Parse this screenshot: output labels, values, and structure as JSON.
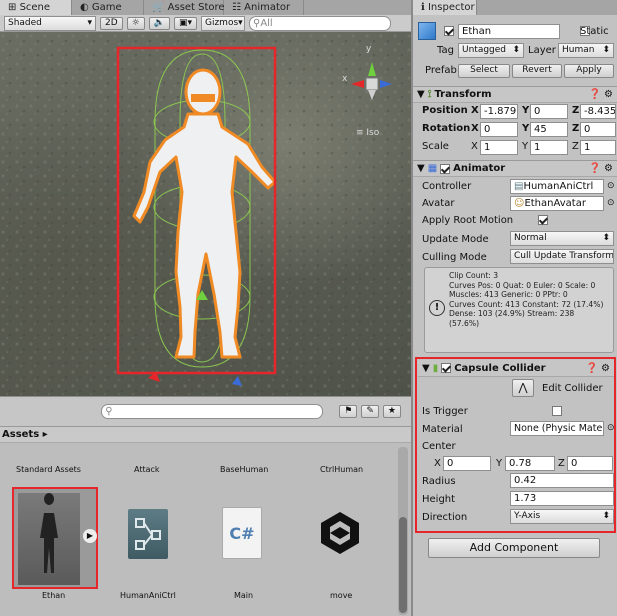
{
  "scene_panel": {
    "tabs": [
      "Scene",
      "Game",
      "Asset Store",
      "Animator"
    ],
    "shading_mode": "Shaded",
    "toggle_2d": "2D",
    "gizmos_label": "Gizmos",
    "search_placeholder": "All",
    "gizmo_axes": {
      "y": "y",
      "x": "x"
    },
    "iso_label": "Iso"
  },
  "inspector": {
    "tab": "Inspector",
    "object_name": "Ethan",
    "static_label": "Static",
    "tag_label": "Tag",
    "tag_value": "Untagged",
    "layer_label": "Layer",
    "layer_value": "Human",
    "prefab_label": "Prefab",
    "prefab_buttons": [
      "Select",
      "Revert",
      "Apply"
    ],
    "transform": {
      "title": "Transform",
      "rows": [
        {
          "label": "Position",
          "x": "-1.879",
          "y": "0",
          "z": "-8.435"
        },
        {
          "label": "Rotation",
          "x": "0",
          "y": "45",
          "z": "0"
        },
        {
          "label": "Scale",
          "x": "1",
          "y": "1",
          "z": "1"
        }
      ],
      "axis_labels": [
        "X",
        "Y",
        "Z"
      ]
    },
    "animator": {
      "title": "Animator",
      "controller_label": "Controller",
      "controller_value": "HumanAniCtrl",
      "avatar_label": "Avatar",
      "avatar_value": "EthanAvatar",
      "apply_root_motion_label": "Apply Root Motion",
      "update_mode_label": "Update Mode",
      "update_mode_value": "Normal",
      "culling_mode_label": "Culling Mode",
      "culling_mode_value": "Cull Update Transforms",
      "info_lines": [
        "Clip Count: 3",
        "Curves Pos: 0 Quat: 0 Euler: 0 Scale: 0",
        "Muscles: 413 Generic: 0 PPtr: 0",
        "Curves Count: 413 Constant: 72 (17.4%)",
        "Dense: 103 (24.9%) Stream: 238",
        "(57.6%)"
      ]
    },
    "capsule_collider": {
      "title": "Capsule Collider",
      "edit_collider_label": "Edit Collider",
      "is_trigger_label": "Is Trigger",
      "material_label": "Material",
      "material_value": "None (Physic Materi",
      "center_label": "Center",
      "center": {
        "x": "0",
        "y": "0.78",
        "z": "0"
      },
      "radius_label": "Radius",
      "radius_value": "0.42",
      "height_label": "Height",
      "height_value": "1.73",
      "direction_label": "Direction",
      "direction_value": "Y-Axis"
    },
    "add_component_label": "Add Component"
  },
  "assets_panel": {
    "breadcrumb": "Assets",
    "top_labels": [
      "Standard Assets",
      "Attack",
      "BaseHuman",
      "CtrlHuman"
    ],
    "items": [
      {
        "name": "Ethan",
        "icon": "character-thumbnail-icon"
      },
      {
        "name": "HumanAniCtrl",
        "icon": "animator-controller-icon"
      },
      {
        "name": "Main",
        "icon": "csharp-script-icon",
        "glyph": "C#"
      },
      {
        "name": "move",
        "icon": "unity-logo-icon"
      }
    ]
  },
  "colors": {
    "highlight_red": "#e5262a",
    "selection_orange": "#f08a24",
    "collider_green": "#8fd14f"
  }
}
